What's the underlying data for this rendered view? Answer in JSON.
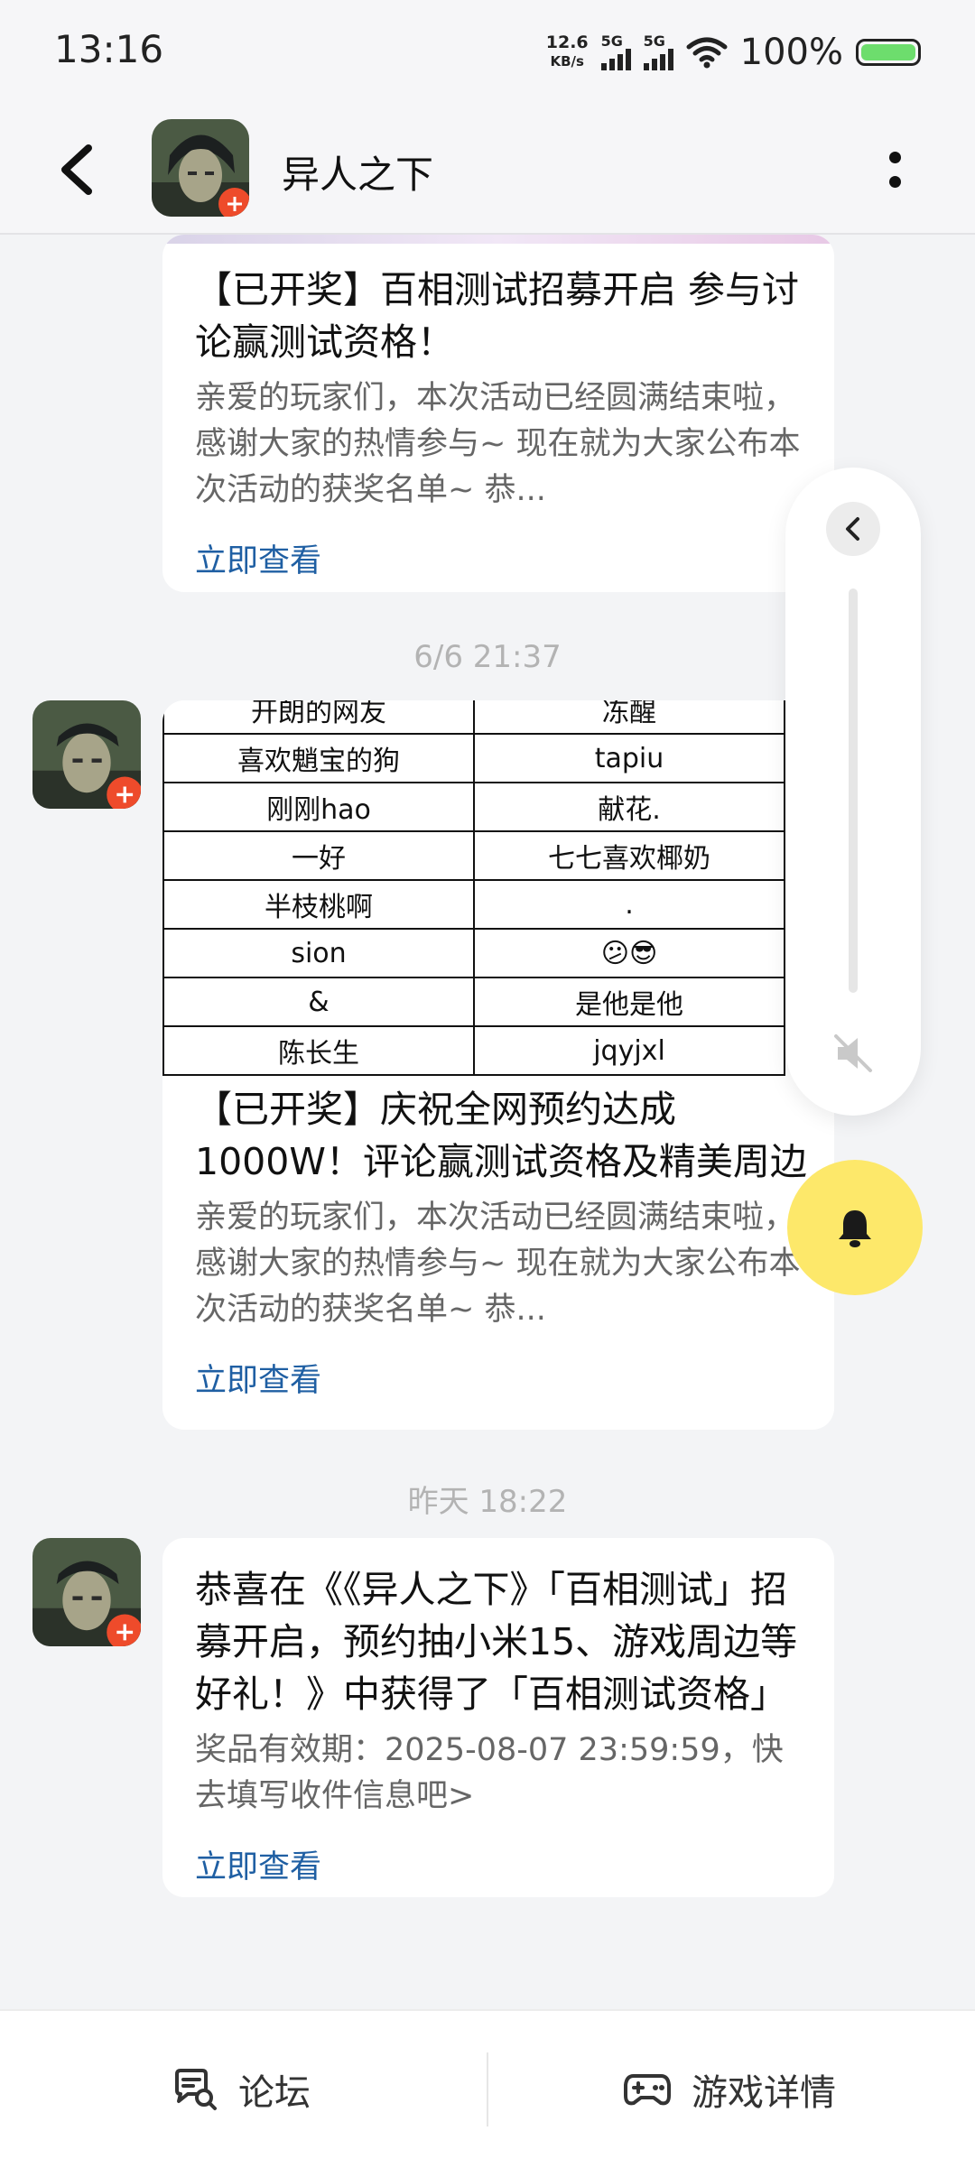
{
  "status_bar": {
    "time": "13:16",
    "net_speed_value": "12.6",
    "net_speed_unit": "KB/s",
    "sim1_label": "5G",
    "sim2_label": "5G",
    "battery": "100%",
    "battery_level": 1.0,
    "battery_color": "#6ddd6d"
  },
  "header": {
    "title": "异人之下",
    "back_icon": "chevron-left-icon",
    "more_icon": "more-vertical-icon"
  },
  "messages": [
    {
      "title": "【已开奖】百相测试招募开启 参与讨论赢测试资格！",
      "description": "亲爱的玩家们，本次活动已经圆满结束啦，感谢大家的热情参与~ 现在就为大家公布本次活动的获奖名单~ 恭...",
      "link": "立即查看"
    },
    {
      "timestamp": "6/6  21:37",
      "table_rows": [
        [
          "开朗的网友",
          "冻醒"
        ],
        [
          "喜欢魈宝的狗",
          "tapiu"
        ],
        [
          "刚刚hao",
          "献花."
        ],
        [
          "一好",
          "七七喜欢椰奶"
        ],
        [
          "半枝桃啊",
          "."
        ],
        [
          "sion",
          "😕😎"
        ],
        [
          "&",
          "是他是他"
        ],
        [
          "陈长生",
          "jqyjxl"
        ]
      ],
      "title": "【已开奖】庆祝全网预约达成1000W！评论赢测试资格及精美周边",
      "description": "亲爱的玩家们，本次活动已经圆满结束啦，感谢大家的热情参与~ 现在就为大家公布本次活动的获奖名单~ 恭...",
      "link": "立即查看"
    },
    {
      "timestamp": "昨天  18:22",
      "title": "恭喜在《《异人之下》「百相测试」招募开启，预约抽小米15、游戏周边等好礼！》中获得了「百相测试资格」",
      "description": "奖品有效期：2025-08-07 23:59:59，快去填写收件信息吧>",
      "link": "立即查看"
    }
  ],
  "side_panel": {
    "collapse_icon": "chevron-left-icon",
    "mute_icon": "volume-mute-icon",
    "bell_icon": "bell-icon",
    "bell_color": "#fde86a"
  },
  "bottom_tabs": [
    {
      "label": "论坛",
      "icon": "forum-search-icon"
    },
    {
      "label": "游戏详情",
      "icon": "gamepad-icon"
    }
  ],
  "colors": {
    "link": "#1f5fa3",
    "background": "#f3f4f6"
  }
}
